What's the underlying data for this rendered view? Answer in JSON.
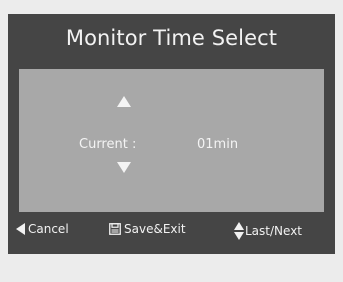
{
  "dialog": {
    "title": "Monitor Time Select",
    "current_label": "Current :",
    "current_value": "01min",
    "up_icon": "triangle-up-icon",
    "down_icon": "triangle-down-icon"
  },
  "footer": {
    "cancel_label": "Cancel",
    "cancel_icon": "triangle-left-icon",
    "save_label": "Save&Exit",
    "save_icon": "save-icon",
    "nav_label": "Last/Next",
    "nav_icon": "up-down-arrow-icon"
  },
  "colors": {
    "panel": "#454545",
    "content": "#a8a8a8",
    "text": "#f2f2f2",
    "page": "#ececec"
  }
}
